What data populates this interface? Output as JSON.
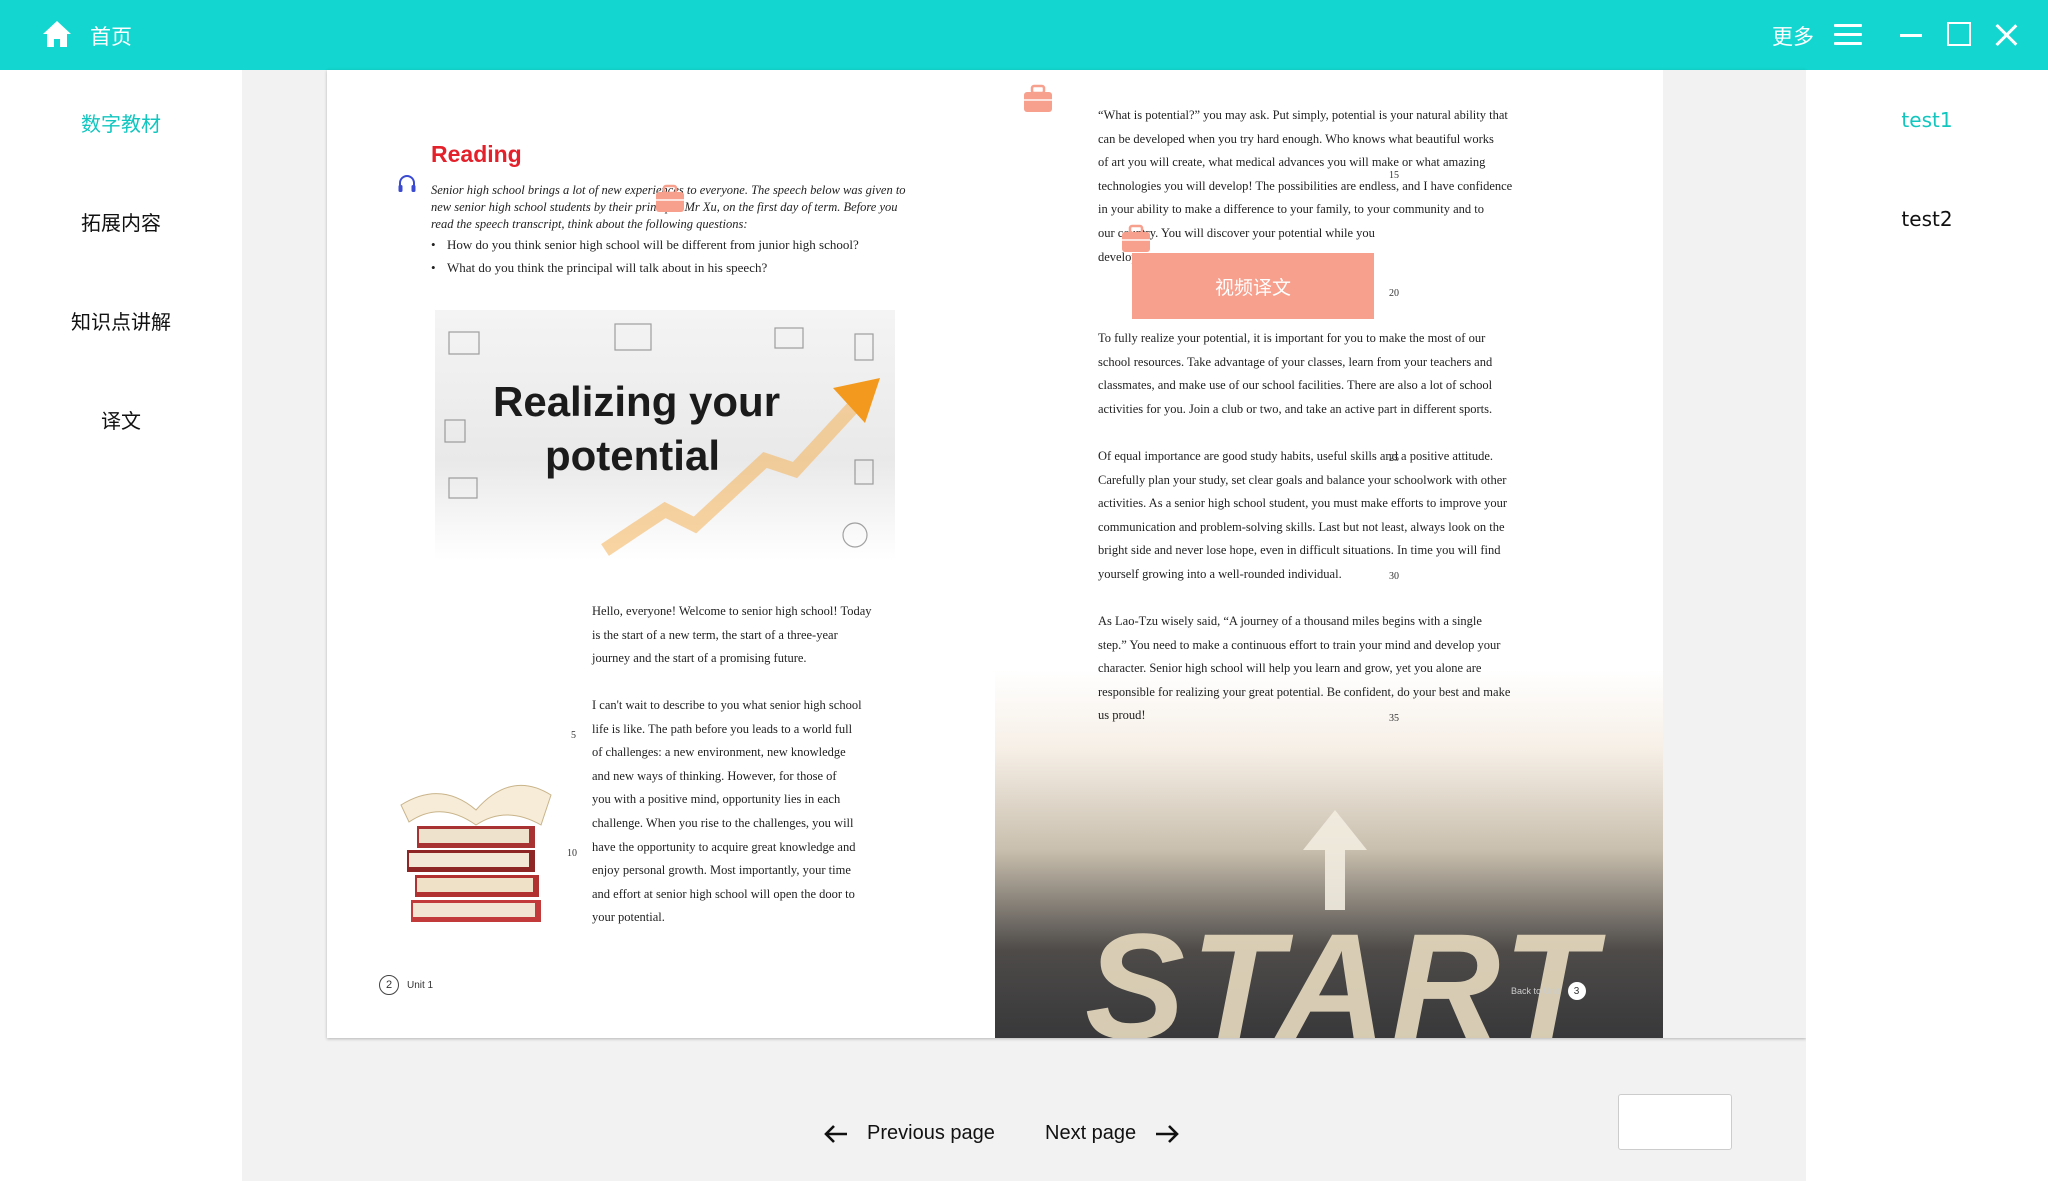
{
  "titlebar": {
    "home_label": "首页",
    "more_label": "更多"
  },
  "left_nav": {
    "items": [
      {
        "label": "数字教材"
      },
      {
        "label": "拓展内容"
      },
      {
        "label": "知识点讲解"
      },
      {
        "label": "译文"
      }
    ]
  },
  "right_nav": {
    "items": [
      {
        "label": "test1"
      },
      {
        "label": "test2"
      }
    ]
  },
  "book": {
    "left_page": {
      "section_title": "Reading",
      "intro": "Senior high school brings a lot of new experiences to everyone. The speech below was given to new senior high school students by their principal Mr Xu, on the first day of term. Before you read the speech transcript, think about the following questions:",
      "questions": [
        "How do you think senior high school will be different from junior high school?",
        "What do you think the principal will talk about in his speech?"
      ],
      "banner_line1": "Realizing your",
      "banner_line2": "potential",
      "paragraphs": [
        [
          "Hello, everyone! Welcome to senior high school! Today",
          "is the start of a new term, the start of a three-year",
          "journey and the start of a promising future."
        ],
        [
          "I can't wait to describe to you what senior high school",
          "life is like. The path before you leads to a world full",
          "of challenges: a new environment, new knowledge",
          "and new ways of thinking. However, for those of",
          "you with a positive mind, opportunity lies in each",
          "challenge. When you rise to the challenges, you will",
          "have the opportunity to acquire great knowledge and",
          "enjoy personal growth. Most importantly, your time",
          "and effort at senior high school will open the door to",
          "your potential."
        ]
      ],
      "line_numbers": [
        "5",
        "10"
      ],
      "page_number": "2",
      "footer_label": "Unit 1"
    },
    "right_page": {
      "paragraphs": [
        [
          "“What is potential?” you may ask. Put simply, potential is your natural ability that",
          "can be developed when you try hard enough. Who knows what beautiful works",
          "of art you will create, what medical advances you will make or what amazing",
          "technologies you will develop! The possibilities are endless, and I have confidence",
          "in your ability to make a difference to your family, to your community and to",
          "our country. You will discover your potential while you",
          "develop."
        ],
        [
          "To fully realize your potential, it is important for you to make the most of our",
          "school resources. Take advantage of your classes, learn from your teachers and",
          "classmates, and make use of our school facilities. There are also a lot of school",
          "activities for you. Join a club or two, and take an active part in different sports."
        ],
        [
          "Of equal importance are good study habits, useful skills and a positive attitude.",
          "Carefully plan your study, set clear goals and balance your schoolwork with other",
          "activities. As a senior high school student, you must make efforts to improve your",
          "communication and problem-solving skills. Last but not least, always look on the",
          "bright side and never lose hope, even in difficult situations. In time you will find",
          "yourself growing into a well-rounded individual."
        ],
        [
          "As Lao-Tzu wisely said, “A journey of a thousand miles begins with a single",
          "step.” You need to make a continuous effort to train your mind and develop your",
          "character. Senior high school will help you learn and grow, yet you alone are",
          "responsible for realizing your great potential. Be confident, do your best and make",
          "us proud!"
        ]
      ],
      "line_numbers": [
        "15",
        "20",
        "25",
        "30",
        "35"
      ],
      "road_text": "START",
      "footer_label": "Back to Unit",
      "page_number": "3"
    },
    "popup_label": "视频译文"
  },
  "pager": {
    "prev_label": "Previous page",
    "next_label": "Next page",
    "page_input_value": ""
  },
  "colors": {
    "accent": "#12d6cf",
    "popup": "#f7a08e",
    "reading_title": "#e4212b"
  }
}
